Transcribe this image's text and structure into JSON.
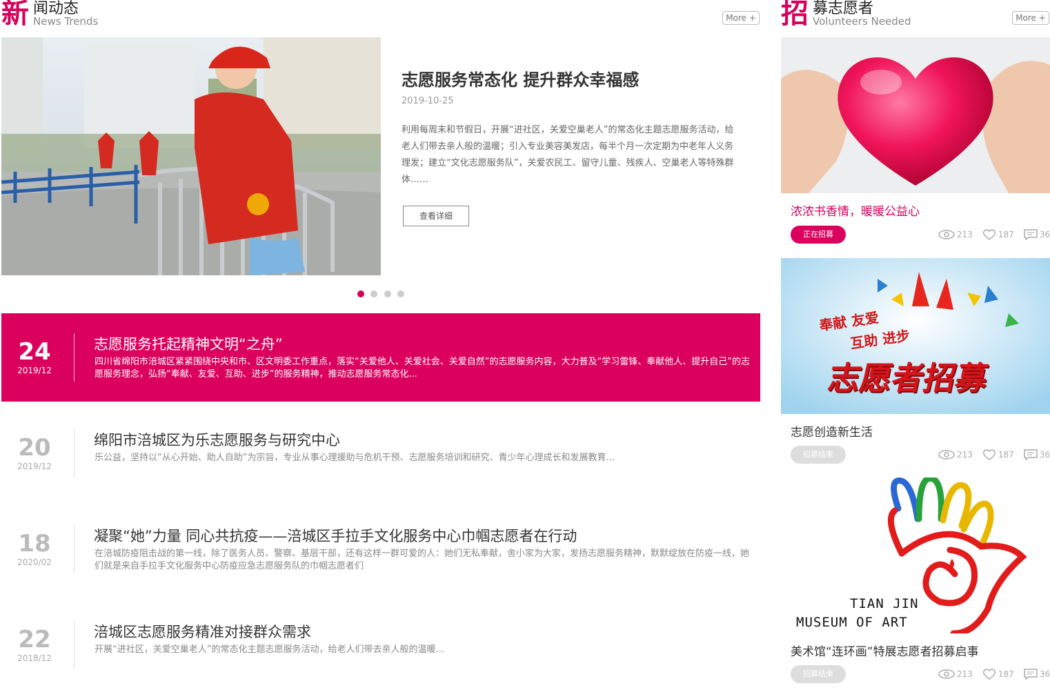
{
  "news_section": {
    "title_big": "新",
    "title_rest": "闻动态",
    "subtitle": "News Trends",
    "more": "More +"
  },
  "volunteer_section": {
    "title_big": "招",
    "title_rest": "募志愿者",
    "subtitle": "Volunteers Needed",
    "more": "More +"
  },
  "featured": {
    "title": "志愿服务常态化 提升群众幸福感",
    "date": "2019-10-25",
    "description": "利用每周末和节假日，开展“进社区，关爱空巢老人”的常态化主题志愿服务活动，给老人们带去亲人般的温暖；引入专业美容美发店，每半个月一次定期为中老年人义务理发；建立“文化志愿服务队”，关爱农民工、留守儿童、残疾人、空巢老人等特殊群体……",
    "detail_button": "查看详细",
    "slide_count": 4,
    "active_slide": 1
  },
  "news_list": [
    {
      "day": "24",
      "year_month": "2019/12",
      "title": "志愿服务托起精神文明“之舟”",
      "description": "四川省绵阳市涪城区紧紧围绕中央和市、区文明委工作重点，落实“关爱他人、关爱社会、关爱自然”的志愿服务内容，大力普及“学习雷锋、奉献他人、提升自己”的志愿服务理念，弘扬“奉献、友爱、互助、进步”的服务精神，推动志愿服务常态化..."
    },
    {
      "day": "20",
      "year_month": "2019/12",
      "title": "绵阳市涪城区为乐志愿服务与研究中心",
      "description": "乐公益，坚持以“从心开始、助人自助”为宗旨，专业从事心理援助与危机干预、志愿服务培训和研究、青少年心理成长和发展教育..."
    },
    {
      "day": "18",
      "year_month": "2020/02",
      "title": "凝聚“她”力量 同心共抗疫——涪城区手拉手文化服务中心巾帼志愿者在行动",
      "description": "在涪城防疫阻击战的第一线，除了医务人员、警察、基层干部，还有这样一群可爱的人：她们无私奉献，舍小家为大家，发扬志愿服务精神，默默绽放在防疫一线，她们就是来自手拉手文化服务中心防疫应急志愿服务队的巾帼志愿者们"
    },
    {
      "day": "22",
      "year_month": "2018/12",
      "title": "涪城区志愿服务精准对接群众需求",
      "description": "开展“进社区，关爱空巢老人”的常态化主题志愿服务活动，给老人们带去亲人般的温暖..."
    }
  ],
  "volunteers": [
    {
      "title": "浓浓书香情，暖暖公益心",
      "status": "正在招募",
      "views": "213",
      "likes": "187",
      "comments": "36"
    },
    {
      "title": "志愿创造新生活",
      "status": "招募结束",
      "views": "213",
      "likes": "187",
      "comments": "36",
      "poster_line1": "奉献 友爱",
      "poster_line2": "互助 进步",
      "poster_main": "志愿者招募"
    },
    {
      "title": "美术馆“连环画”特展志愿者招募启事",
      "status": "招募结束",
      "views": "213",
      "likes": "187",
      "comments": "36",
      "logo_line1": "TIAN JIN",
      "logo_line2": "MUSEUM OF ART"
    }
  ],
  "colors": {
    "accent": "#dc005e",
    "muted": "#aaaaaa"
  }
}
